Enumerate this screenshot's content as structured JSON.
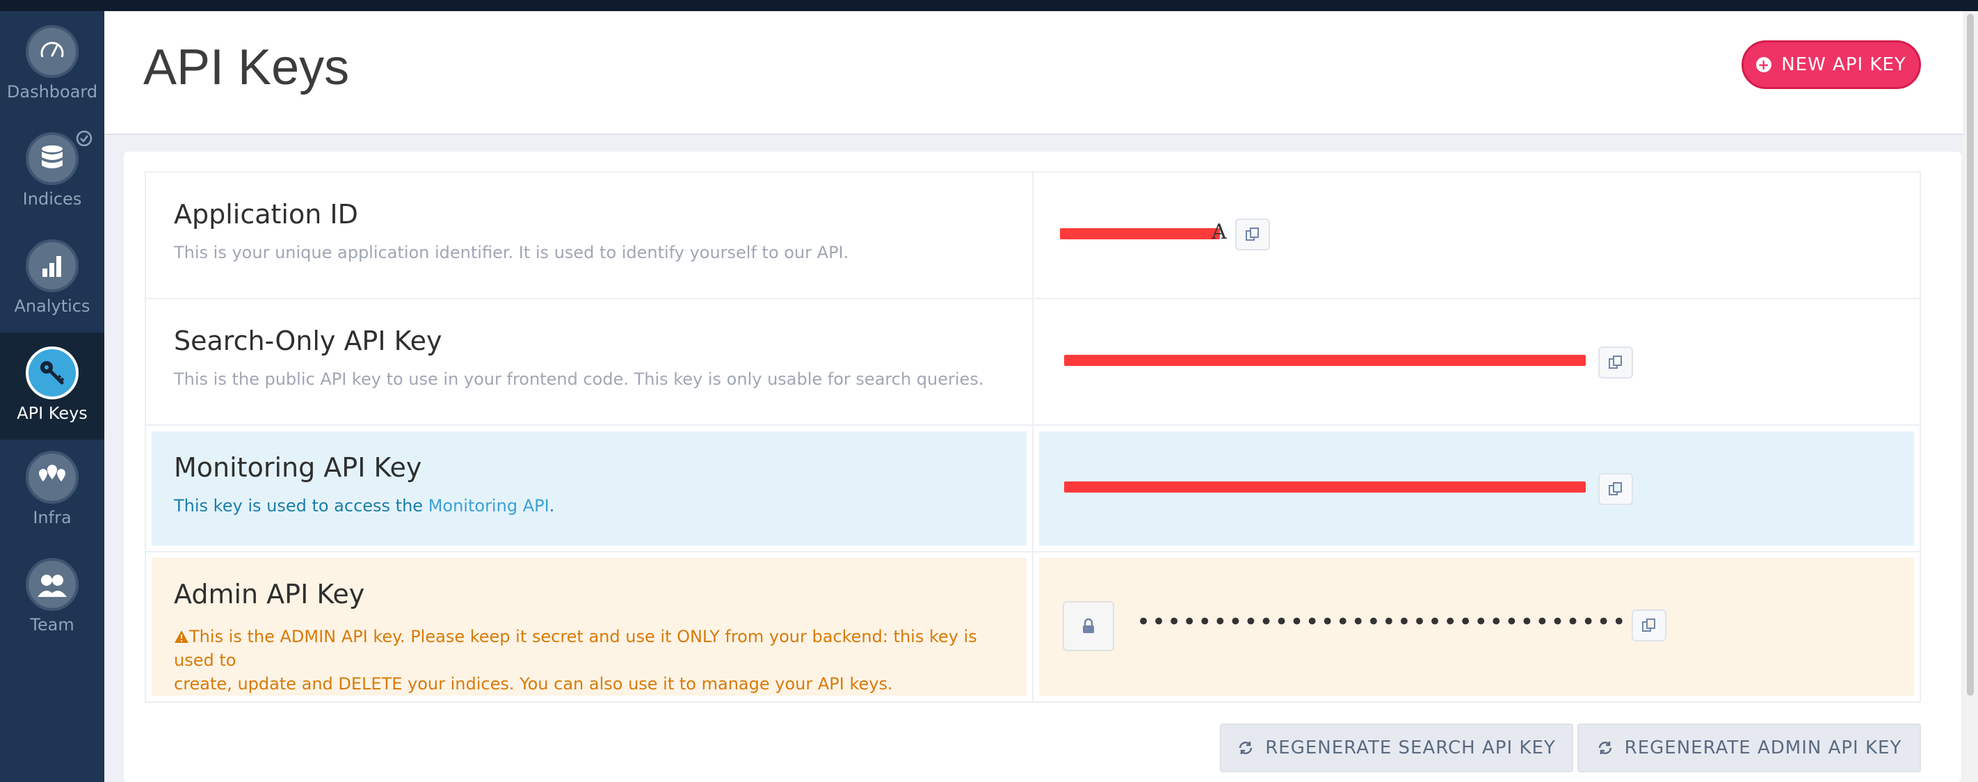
{
  "sidebar": {
    "items": [
      {
        "label": "Dashboard",
        "icon": "dashboard-gauge-icon"
      },
      {
        "label": "Indices",
        "icon": "database-icon"
      },
      {
        "label": "Analytics",
        "icon": "bar-chart-icon"
      },
      {
        "label": "API Keys",
        "icon": "key-icon",
        "active": true
      },
      {
        "label": "Infra",
        "icon": "map-pin-icon"
      },
      {
        "label": "Team",
        "icon": "team-icon"
      }
    ]
  },
  "header": {
    "title": "API Keys",
    "new_key_button": "NEW API KEY"
  },
  "rows": {
    "app_id": {
      "title": "Application ID",
      "desc": "This is your unique application identifier. It is used to identify yourself to our API.",
      "value_suffix": "A"
    },
    "search_key": {
      "title": "Search-Only API Key",
      "desc": "This is the public API key to use in your frontend code. This key is only usable for search queries."
    },
    "monitoring_key": {
      "title": "Monitoring API Key",
      "desc_prefix": "This key is used to access the ",
      "desc_link": "Monitoring API",
      "desc_suffix": "."
    },
    "admin_key": {
      "title": "Admin API Key",
      "warning_line1": "This is the ADMIN API key. Please keep it secret and use it ONLY from your backend: this key is used to",
      "warning_line2": "create, update and DELETE your indices. You can also use it to manage your API keys.",
      "masked": "••••••••••••••••••••••••••••••••"
    }
  },
  "actions": {
    "regen_search": "REGENERATE SEARCH API KEY",
    "regen_admin": "REGENERATE ADMIN API KEY"
  },
  "colors": {
    "accent": "#ef3364",
    "sidebar": "#1e3553",
    "active_nav": "#3aa7dd",
    "monitoring_bg": "#e4f3fa",
    "admin_bg": "#fdf4e6",
    "warning": "#d97a08",
    "redaction": "#ff1f1f"
  }
}
